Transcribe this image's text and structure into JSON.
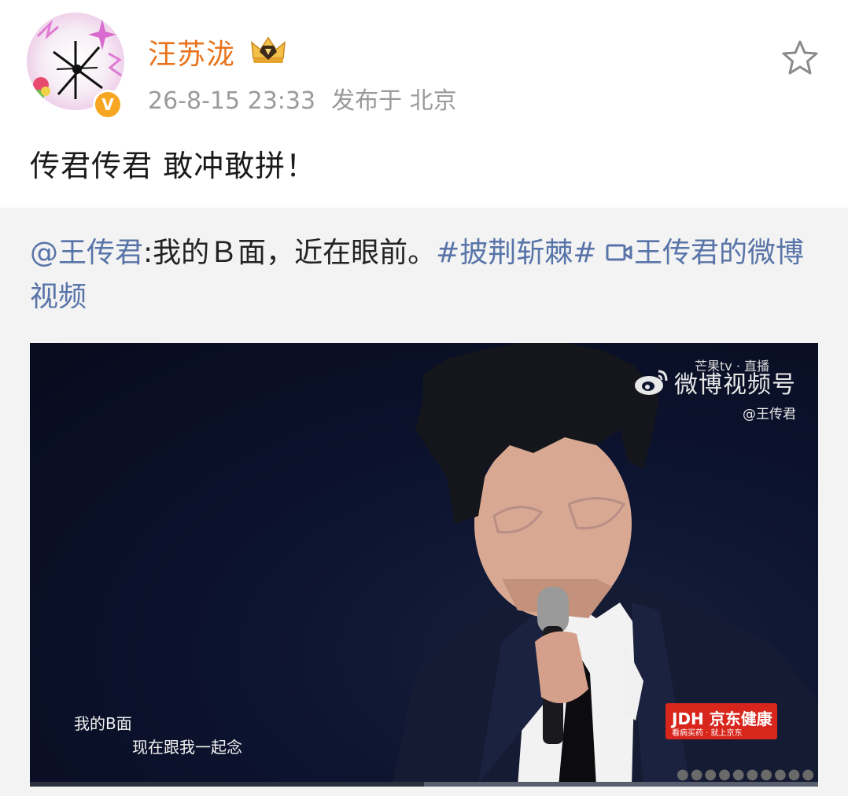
{
  "post": {
    "username": "汪苏泷",
    "time": "26-8-15 23:33",
    "location": "发布于 北京",
    "text": "传君传君 敢冲敢拼！",
    "verified_badge": "V"
  },
  "repost": {
    "mention": "@王传君",
    "text": ":我的Ｂ面，近在眼前。",
    "hashtag": "#披荆斩棘#",
    "video_link": "王传君的微博视频"
  },
  "video": {
    "watermark_mango": "芒果tv · 直播",
    "watermark_brand": "微博视频号",
    "watermark_handle": "@王传君",
    "subtitle_line1": "我的B面",
    "subtitle_line2": "现在跟我一起念",
    "ad_main": "JDH 京东健康",
    "ad_sub": "看病买药 · 就上京东",
    "progress": 0.5
  },
  "colors": {
    "username": "#e8731c",
    "link": "#5874a8",
    "meta": "#9a9a9a"
  },
  "icons": {
    "star": "star-icon",
    "verified": "verified-icon",
    "video": "video-icon",
    "weibo": "weibo-logo-icon"
  }
}
